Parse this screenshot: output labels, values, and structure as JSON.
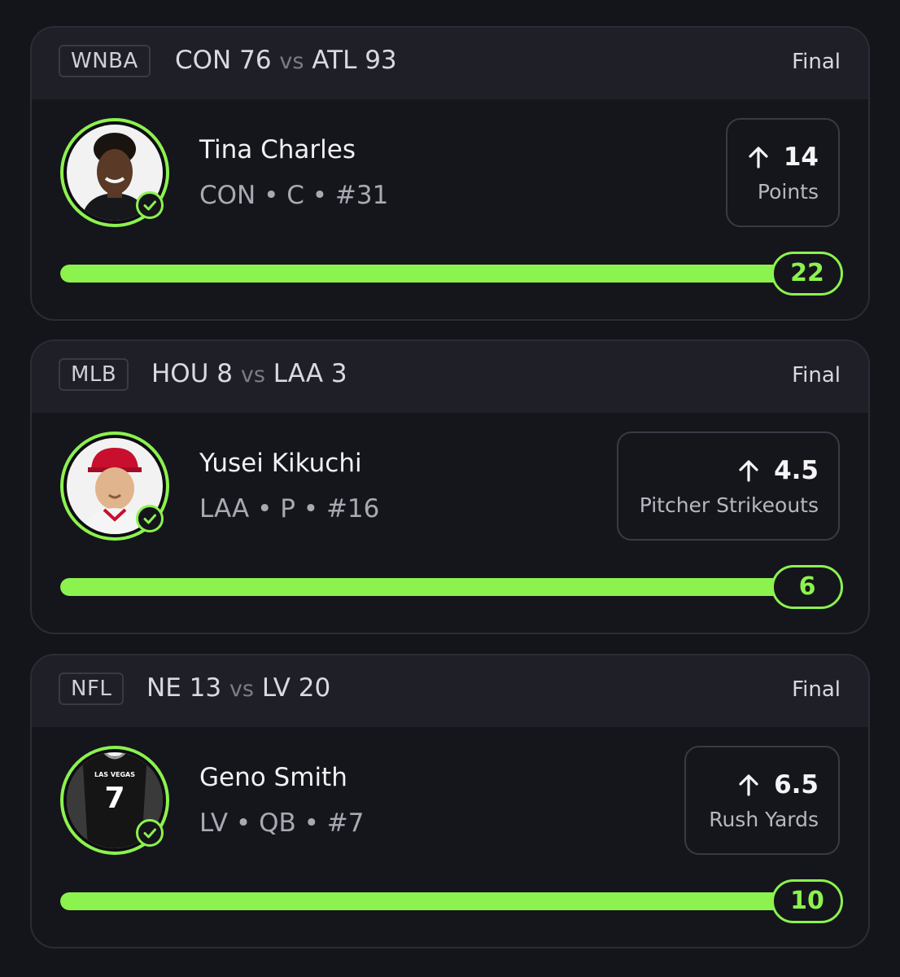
{
  "accent_color": "#8cf24e",
  "cards": [
    {
      "league": "WNBA",
      "home_team": "CON",
      "home_score": "76",
      "vs": "vs",
      "away_team": "ATL",
      "away_score": "93",
      "status": "Final",
      "player": {
        "name": "Tina Charles",
        "meta": "CON • C • #31",
        "avatar": "player-photo-avatar",
        "verified_icon": "check-circle-icon"
      },
      "prop": {
        "direction_icon": "arrow-up-icon",
        "line": "14",
        "stat": "Points"
      },
      "result": "22",
      "progress": 1.0
    },
    {
      "league": "MLB",
      "home_team": "HOU",
      "home_score": "8",
      "vs": "vs",
      "away_team": "LAA",
      "away_score": "3",
      "status": "Final",
      "player": {
        "name": "Yusei Kikuchi",
        "meta": "LAA • P • #16",
        "avatar": "player-photo-avatar",
        "verified_icon": "check-circle-icon"
      },
      "prop": {
        "direction_icon": "arrow-up-icon",
        "line": "4.5",
        "stat": "Pitcher Strikeouts"
      },
      "result": "6",
      "progress": 1.0
    },
    {
      "league": "NFL",
      "home_team": "NE",
      "home_score": "13",
      "vs": "vs",
      "away_team": "LV",
      "away_score": "20",
      "status": "Final",
      "player": {
        "name": "Geno Smith",
        "meta": "LV • QB • #7",
        "avatar": "jersey-avatar",
        "jersey_text": "LAS VEGAS",
        "jersey_number": "7",
        "verified_icon": "check-circle-icon"
      },
      "prop": {
        "direction_icon": "arrow-up-icon",
        "line": "6.5",
        "stat": "Rush Yards"
      },
      "result": "10",
      "progress": 1.0
    }
  ]
}
